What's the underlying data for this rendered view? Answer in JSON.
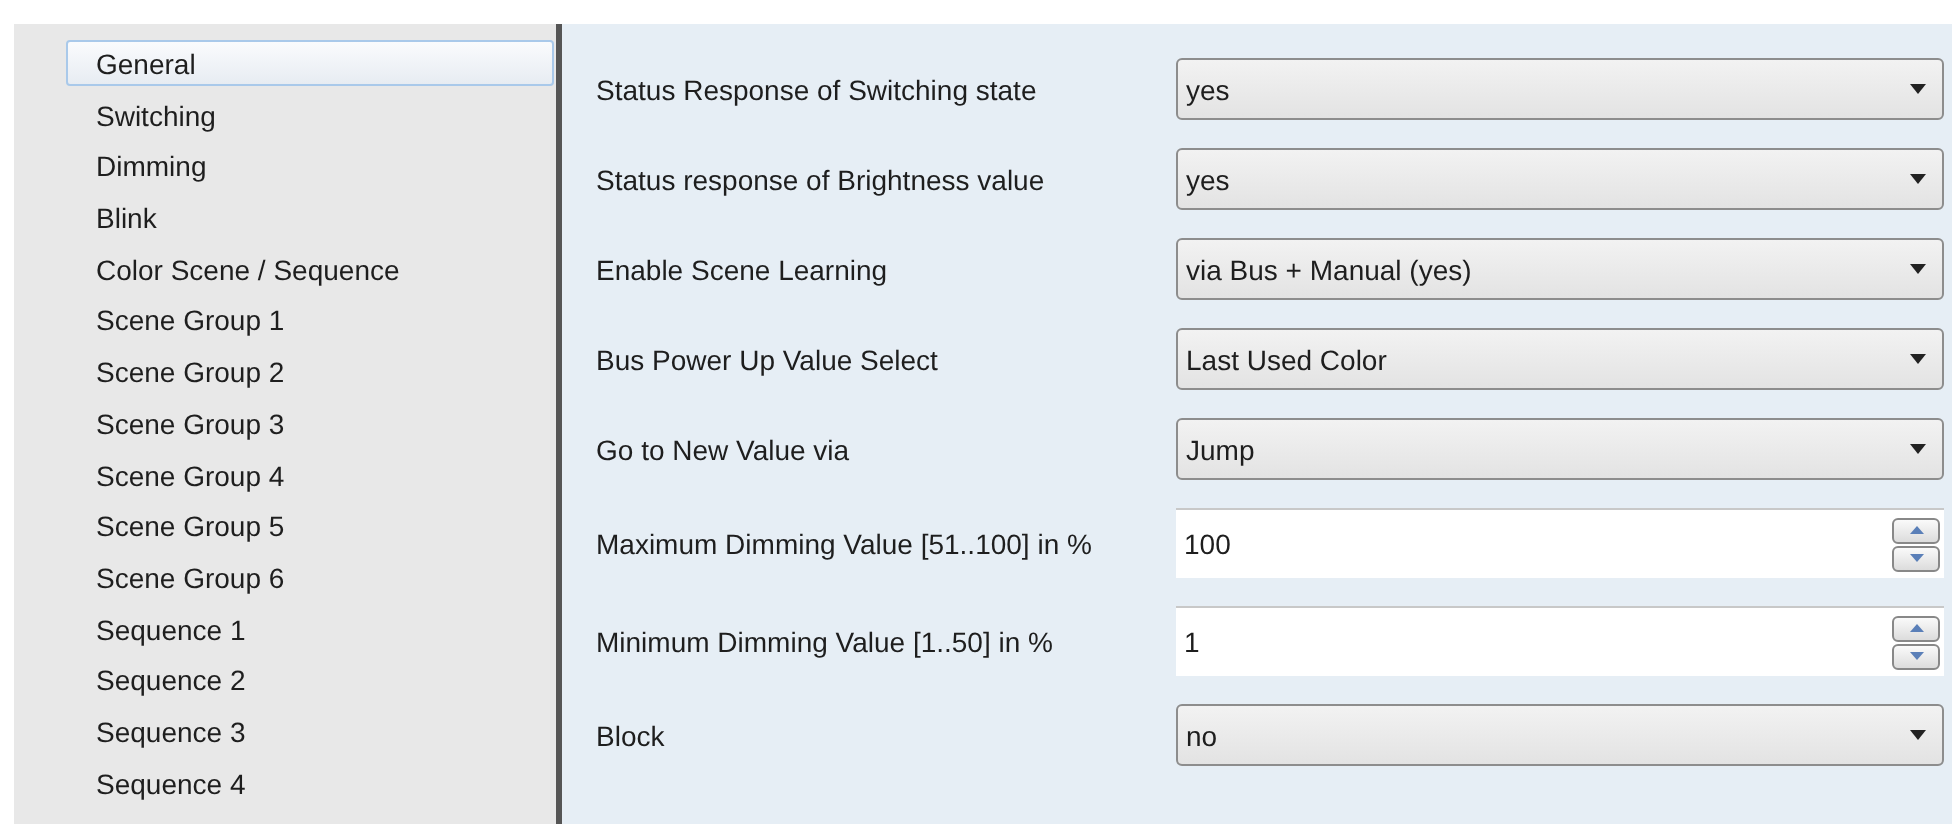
{
  "sidebar": {
    "items": [
      {
        "label": "General",
        "selected": true
      },
      {
        "label": "Switching",
        "selected": false
      },
      {
        "label": "Dimming",
        "selected": false
      },
      {
        "label": "Blink",
        "selected": false
      },
      {
        "label": "Color Scene / Sequence",
        "selected": false
      },
      {
        "label": "Scene Group 1",
        "selected": false
      },
      {
        "label": "Scene Group 2",
        "selected": false
      },
      {
        "label": "Scene Group 3",
        "selected": false
      },
      {
        "label": "Scene Group 4",
        "selected": false
      },
      {
        "label": "Scene Group 5",
        "selected": false
      },
      {
        "label": "Scene Group 6",
        "selected": false
      },
      {
        "label": "Sequence 1",
        "selected": false
      },
      {
        "label": "Sequence 2",
        "selected": false
      },
      {
        "label": "Sequence 3",
        "selected": false
      },
      {
        "label": "Sequence 4",
        "selected": false
      }
    ]
  },
  "parameters": [
    {
      "label": "Status Response of Switching state",
      "kind": "dropdown",
      "value": "yes"
    },
    {
      "label": "Status response of Brightness value",
      "kind": "dropdown",
      "value": "yes"
    },
    {
      "label": "Enable Scene Learning",
      "kind": "dropdown",
      "value": "via Bus + Manual (yes)"
    },
    {
      "label": "Bus Power Up Value Select",
      "kind": "dropdown",
      "value": "Last Used Color"
    },
    {
      "label": "Go to New Value via",
      "kind": "dropdown",
      "value": "Jump"
    },
    {
      "label": "Maximum Dimming Value [51..100] in %",
      "kind": "spinner",
      "value": "100"
    },
    {
      "label": "Minimum Dimming Value [1..50] in %",
      "kind": "spinner",
      "value": "1"
    },
    {
      "label": "Block",
      "kind": "dropdown",
      "value": "no"
    }
  ]
}
